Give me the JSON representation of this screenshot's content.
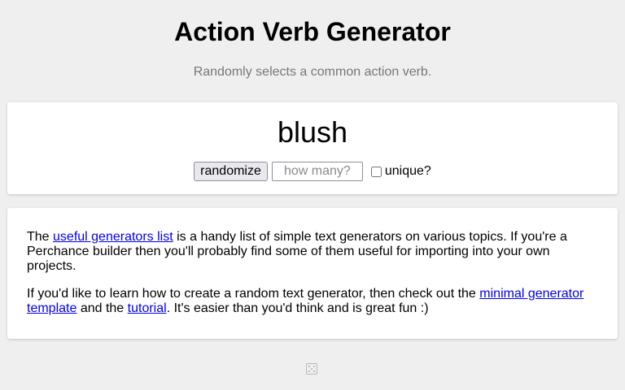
{
  "header": {
    "title": "Action Verb Generator",
    "subtitle": "Randomly selects a common action verb."
  },
  "generator": {
    "result": "blush",
    "randomize_label": "randomize",
    "count_placeholder": "how many?",
    "unique_label": "unique?",
    "unique_checked": false
  },
  "info": {
    "p1_before": "The ",
    "p1_link": "useful generators list",
    "p1_after": " is a handy list of simple text generators on various topics. If you're a Perchance builder then you'll probably find some of them useful for importing into your own projects.",
    "p2_before": "If you'd like to learn how to create a random text generator, then check out the ",
    "p2_link1": "minimal generator template",
    "p2_mid": " and the ",
    "p2_link2": "tutorial",
    "p2_after": ". It's easier than you'd think and is great fun :)"
  },
  "footer": {
    "icon": "dice-icon"
  },
  "colors": {
    "background": "#efefef",
    "card": "#ffffff",
    "link": "#0000ee",
    "subtitle": "#777777"
  }
}
